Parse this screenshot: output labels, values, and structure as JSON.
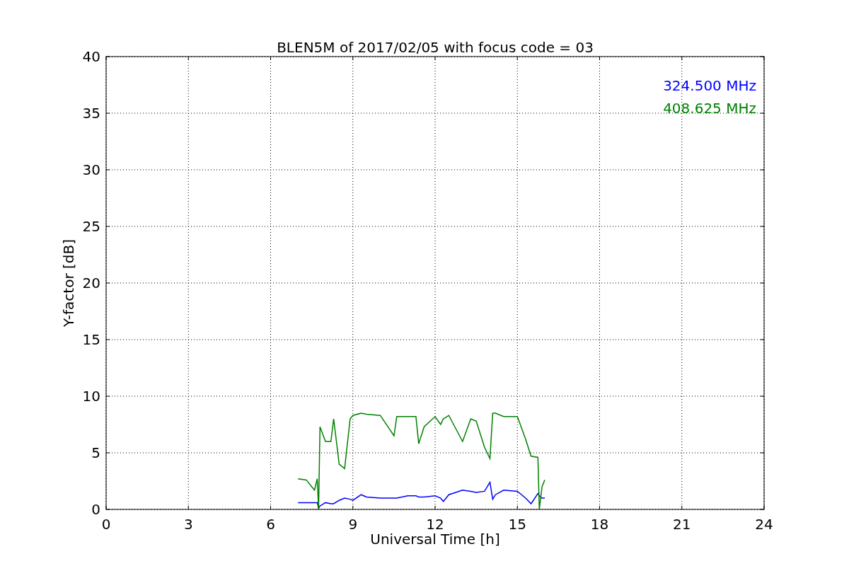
{
  "chart_data": {
    "type": "line",
    "title": "BLEN5M of 2017/02/05 with focus code = 03",
    "xlabel": "Universal Time [h]",
    "ylabel": "Y-factor [dB]",
    "x": [
      7.0,
      7.3,
      7.6,
      7.7,
      7.75,
      7.8,
      8.0,
      8.2,
      8.3,
      8.5,
      8.7,
      8.9,
      9.0,
      9.3,
      9.5,
      10.0,
      10.5,
      10.6,
      11.0,
      11.3,
      11.4,
      11.6,
      12.0,
      12.2,
      12.3,
      12.5,
      13.0,
      13.3,
      13.5,
      13.8,
      14.0,
      14.1,
      14.2,
      14.5,
      15.0,
      15.3,
      15.5,
      15.75,
      15.8,
      15.9,
      16.0
    ],
    "series": [
      {
        "name": "324.500 MHz",
        "color": "#0000ff",
        "values": [
          0.6,
          0.6,
          0.6,
          0.6,
          0.1,
          0.3,
          0.6,
          0.5,
          0.5,
          0.8,
          1.0,
          0.9,
          0.8,
          1.3,
          1.1,
          1.0,
          1.0,
          1.0,
          1.2,
          1.2,
          1.1,
          1.1,
          1.2,
          1.0,
          0.7,
          1.3,
          1.7,
          1.6,
          1.5,
          1.6,
          2.4,
          0.9,
          1.3,
          1.7,
          1.6,
          1.0,
          0.5,
          1.4,
          1.2,
          1.0,
          1.0
        ]
      },
      {
        "name": "408.625 MHz",
        "color": "#008000",
        "values": [
          2.7,
          2.6,
          1.7,
          2.7,
          0,
          7.3,
          6.0,
          6.0,
          8.0,
          4.0,
          3.6,
          8.0,
          8.3,
          8.5,
          8.4,
          8.3,
          6.5,
          8.2,
          8.2,
          8.2,
          5.8,
          7.3,
          8.2,
          7.5,
          8.0,
          8.3,
          6.0,
          8.0,
          7.8,
          5.5,
          4.5,
          8.5,
          8.5,
          8.2,
          8.2,
          6.2,
          4.7,
          4.6,
          0,
          2.0,
          2.6
        ]
      }
    ],
    "grid": true,
    "xlim": [
      0,
      24
    ],
    "ylim": [
      0,
      40
    ],
    "xticks": [
      0,
      3,
      6,
      9,
      12,
      15,
      18,
      21,
      24
    ],
    "yticks": [
      0,
      5,
      10,
      15,
      20,
      25,
      30,
      35,
      40
    ]
  }
}
